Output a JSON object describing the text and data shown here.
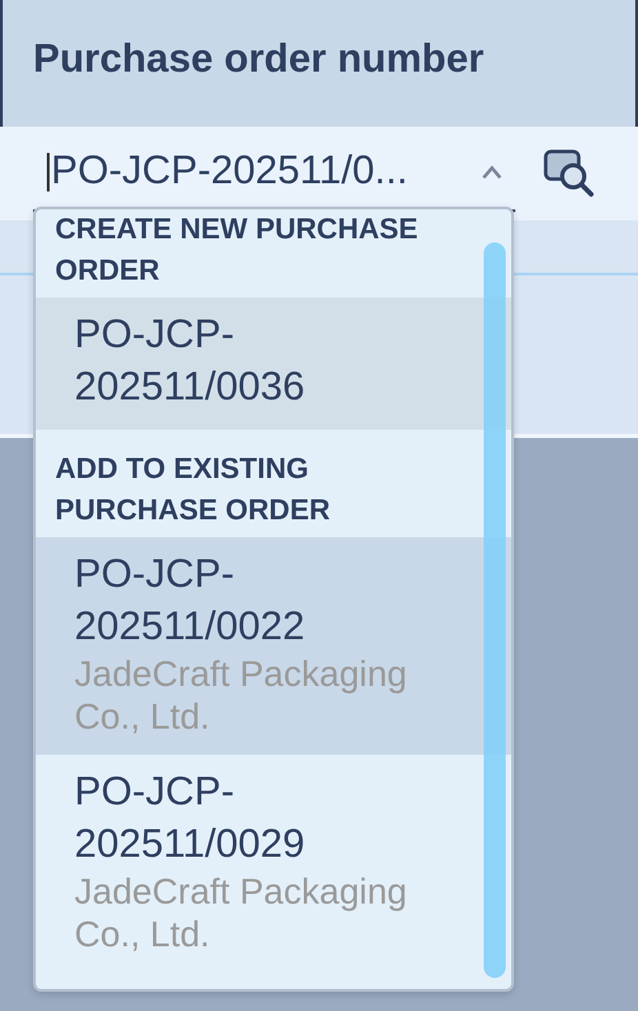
{
  "header": {
    "title": "Purchase order number"
  },
  "field": {
    "value": "PO-JCP-202511/0...",
    "expanded": true
  },
  "dropdown": {
    "groups": [
      {
        "heading": "CREATE NEW PURCHASE ORDER",
        "options": [
          {
            "number": "PO-JCP-202511/0036",
            "highlighted": true,
            "selected": false
          }
        ]
      },
      {
        "heading": "ADD TO EXISTING PURCHASE ORDER",
        "options": [
          {
            "number": "PO-JCP-202511/0022",
            "supplier": "JadeCraft Packaging Co., Ltd.",
            "highlighted": false,
            "selected": true
          },
          {
            "number": "PO-JCP-202511/0029",
            "supplier": "JadeCraft Packaging Co., Ltd.",
            "highlighted": false,
            "selected": false
          }
        ]
      }
    ]
  }
}
